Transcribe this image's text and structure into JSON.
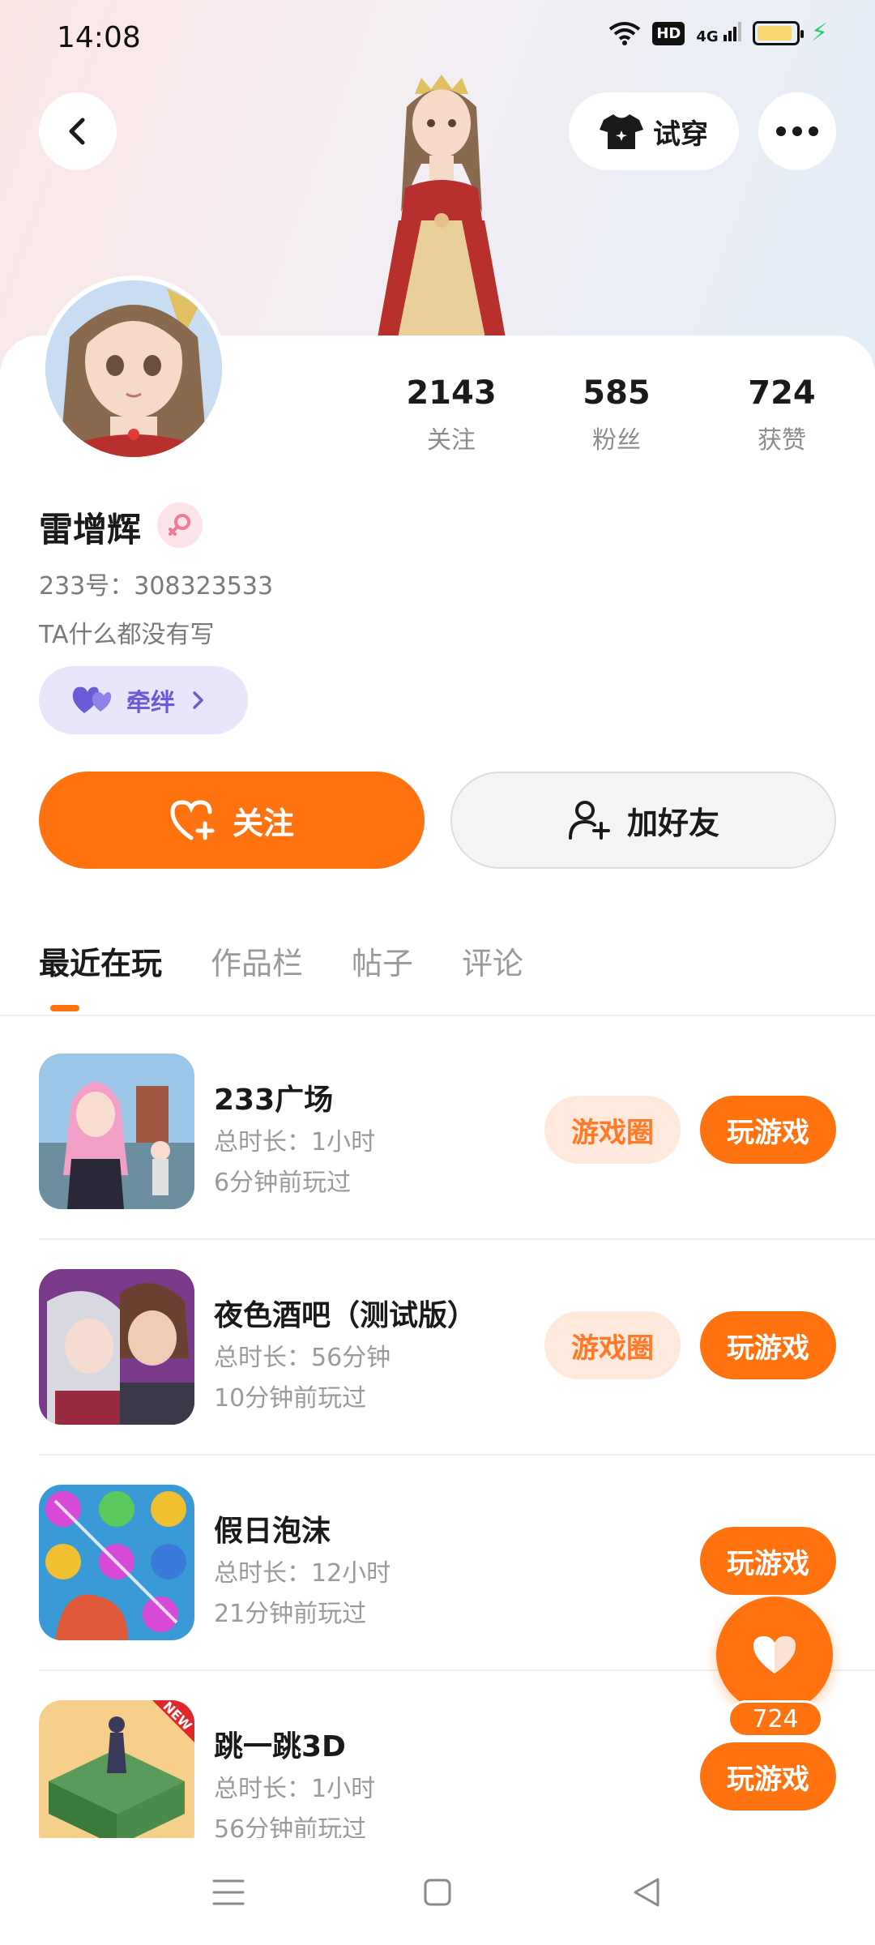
{
  "status_bar": {
    "time": "14:08",
    "hd_label": "HD",
    "network_label": "4G"
  },
  "header": {
    "tryon_label": "试穿"
  },
  "profile": {
    "stats": [
      {
        "value": "2143",
        "label": "关注"
      },
      {
        "value": "585",
        "label": "粉丝"
      },
      {
        "value": "724",
        "label": "获赞"
      }
    ],
    "username": "雷增辉",
    "user_id": "233号：308323533",
    "bio": "TA什么都没有写",
    "bond_label": "牵绊"
  },
  "actions": {
    "follow_label": "关注",
    "add_friend_label": "加好友"
  },
  "tabs": [
    {
      "label": "最近在玩",
      "active": true
    },
    {
      "label": "作品栏",
      "active": false
    },
    {
      "label": "帖子",
      "active": false
    },
    {
      "label": "评论",
      "active": false
    }
  ],
  "games": [
    {
      "name": "233广场",
      "duration": "总时长：1小时",
      "last_played": "6分钟前玩过",
      "circle_label": "游戏圈",
      "play_label": "玩游戏"
    },
    {
      "name": "夜色酒吧（测试版）",
      "duration": "总时长：56分钟",
      "last_played": "10分钟前玩过",
      "circle_label": "游戏圈",
      "play_label": "玩游戏"
    },
    {
      "name": "假日泡沫",
      "duration": "总时长：12小时",
      "last_played": "21分钟前玩过",
      "play_label": "玩游戏"
    },
    {
      "name": "跳一跳3D",
      "duration": "总时长：1小时",
      "last_played": "56分钟前玩过",
      "play_label": "玩游戏",
      "icon_badge": "NEW"
    }
  ],
  "like_fab": {
    "count": "724"
  },
  "colors": {
    "accent": "#ff7210",
    "accent_light": "#ffe8dc",
    "bond_bg": "#e9e6fb",
    "bond_text": "#6b5bd6"
  }
}
